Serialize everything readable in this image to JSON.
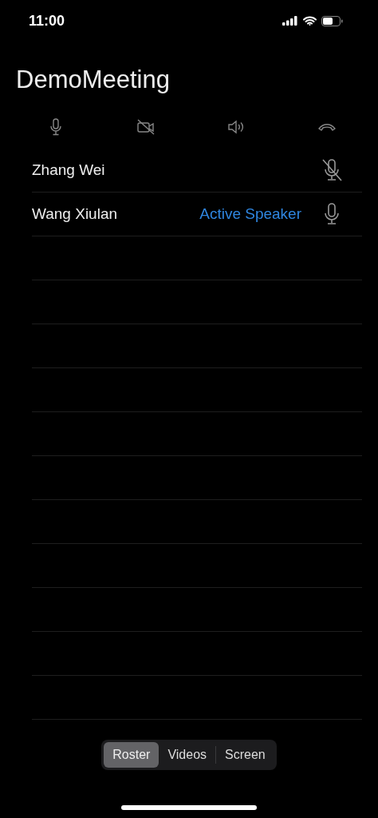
{
  "status_bar": {
    "time": "11:00"
  },
  "title": "DemoMeeting",
  "controls": [
    {
      "kind": "mic"
    },
    {
      "kind": "video_off"
    },
    {
      "kind": "speaker"
    },
    {
      "kind": "hangup"
    }
  ],
  "attendees": [
    {
      "name": "Zhang Wei",
      "muted": true
    },
    {
      "name": "Wang Xiulan",
      "muted": false,
      "status": "Active Speaker"
    }
  ],
  "tabs": [
    {
      "label": "Roster",
      "selected": true
    },
    {
      "label": "Videos",
      "selected": false
    },
    {
      "label": "Screen",
      "selected": false
    }
  ]
}
